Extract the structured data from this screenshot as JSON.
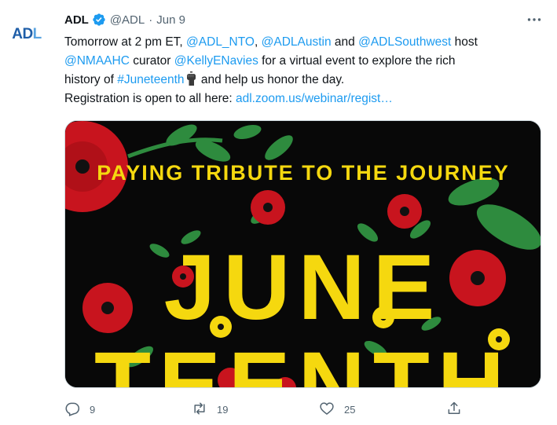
{
  "author": {
    "avatar_text_main": "ADL",
    "name": "ADL",
    "handle": "@ADL",
    "separator": "·",
    "date": "Jun 9"
  },
  "tweet": {
    "line1_prefix": "Tomorrow at 2 pm ET, ",
    "mention_nto": "@ADL_NTO",
    "comma1": ", ",
    "mention_austin": "@ADLAustin",
    "and_text": " and ",
    "mention_southwest": "@ADLSouthwest",
    "host_text": " host",
    "mention_nmaahc": "@NMAAHC",
    "curator_text": " curator ",
    "mention_kelly": "@KellyENavies",
    "line2_suffix": " for a virtual event to explore the rich",
    "line3_prefix": "history of ",
    "hashtag": "#Juneteenth",
    "line3_suffix": " and help us honor the day.",
    "line4_prefix": "Registration is open to all here: ",
    "url": "adl.zoom.us/webinar/regist…"
  },
  "media": {
    "headline": "PAYING TRIBUTE TO THE JOURNEY",
    "big_word_line1": "JUNE",
    "big_word_line2": "TEENTH"
  },
  "actions": {
    "reply_count": "9",
    "retweet_count": "19",
    "like_count": "25"
  },
  "colors": {
    "link": "#1d9bf0",
    "verified": "#1d9bf0",
    "muted": "#536471",
    "media_bg": "#080808",
    "media_yellow": "#f5d80f",
    "media_red": "#c8141e",
    "media_green": "#2e8b3e"
  },
  "icons": {
    "verified": "verified-badge-icon",
    "more": "more-horizontal-icon",
    "emoji": "raised-fist-emoji",
    "reply": "reply-icon",
    "retweet": "retweet-icon",
    "like": "heart-icon",
    "share": "share-icon"
  }
}
